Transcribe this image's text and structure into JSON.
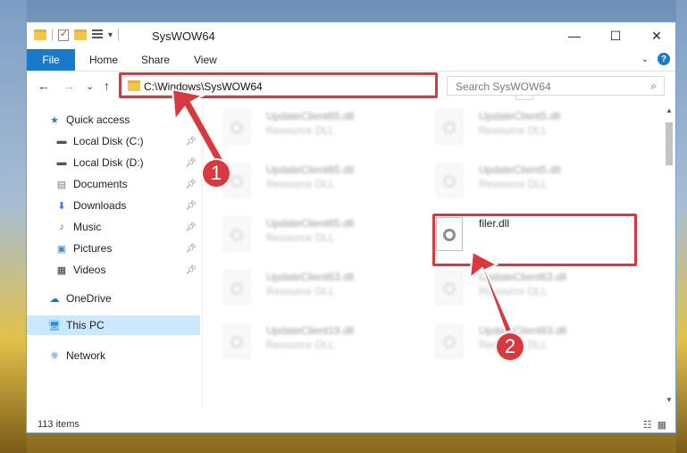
{
  "window": {
    "title": "SysWOW64",
    "controls": {
      "minimize": "—",
      "maximize": "☐",
      "close": "✕"
    }
  },
  "ribbon": {
    "tabs": [
      "File",
      "Home",
      "Share",
      "View"
    ],
    "help": "?"
  },
  "navigation": {
    "back": "←",
    "forward": "→",
    "recent": "⌄",
    "up": "↑",
    "address": "C:\\Windows\\SysWOW64",
    "search_placeholder": "Search SysWOW64"
  },
  "sidebar": {
    "items": [
      {
        "label": "Quick access",
        "icon": "star-icon"
      },
      {
        "label": "Local Disk (C:)",
        "icon": "drive-icon",
        "pinned": true
      },
      {
        "label": "Local Disk (D:)",
        "icon": "drive-icon",
        "pinned": true
      },
      {
        "label": "Documents",
        "icon": "documents-icon",
        "pinned": true
      },
      {
        "label": "Downloads",
        "icon": "downloads-icon",
        "pinned": true
      },
      {
        "label": "Music",
        "icon": "music-icon",
        "pinned": true
      },
      {
        "label": "Pictures",
        "icon": "pictures-icon",
        "pinned": true
      },
      {
        "label": "Videos",
        "icon": "videos-icon",
        "pinned": true
      },
      {
        "label": "OneDrive",
        "icon": "cloud-icon"
      },
      {
        "label": "This PC",
        "icon": "computer-icon",
        "selected": true
      },
      {
        "label": "Network",
        "icon": "network-icon"
      }
    ]
  },
  "files": [
    {
      "name": "UpdateClient65.dll",
      "type": "Resource DLL",
      "blurred": true
    },
    {
      "name": "UpdateClient5.dll",
      "type": "Resource DLL",
      "blurred": true
    },
    {
      "name": "UpdateClient65.dll",
      "type": "Resource DLL",
      "blurred": true
    },
    {
      "name": "UpdateClient5.dll",
      "type": "Resource DLL",
      "blurred": true
    },
    {
      "name": "UpdateClient65.dll",
      "type": "Resource DLL",
      "blurred": true
    },
    {
      "name": "filer.dll",
      "type": "",
      "blurred": false
    },
    {
      "name": "UpdateClient63.dll",
      "type": "Resource DLL",
      "blurred": true
    },
    {
      "name": "UpdateClient63.dll",
      "type": "Resource DLL",
      "blurred": true
    },
    {
      "name": "UpdateClient19.dll",
      "type": "Resource DLL",
      "blurred": true
    },
    {
      "name": "UpdateClient63.dll",
      "type": "Resource DLL",
      "blurred": true
    }
  ],
  "status": {
    "item_count": "113 items"
  },
  "annotations": {
    "step1": "1",
    "step2": "2",
    "color": "#d8393e"
  }
}
